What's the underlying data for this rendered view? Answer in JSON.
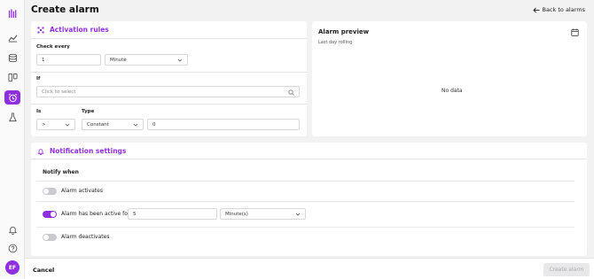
{
  "page": {
    "title": "Create alarm",
    "back_label": "Back to alarms"
  },
  "sidebar": {
    "icons": [
      "logo-bars-icon",
      "chart-icon",
      "layers-icon",
      "board-icon",
      "alarm-clock-icon",
      "flask-icon",
      "bell-icon",
      "help-icon"
    ],
    "avatar": "EF",
    "accent": "#8e2fe0"
  },
  "activation": {
    "title": "Activation rules",
    "check_every_label": "Check every",
    "check_every_value": "1",
    "check_every_unit": "Minute",
    "if_label": "If",
    "if_placeholder": "Click to select",
    "is_label": "Is",
    "is_value": ">",
    "type_label": "Type",
    "type_value": "Constant",
    "threshold_value": "0"
  },
  "preview": {
    "title": "Alarm preview",
    "subtitle": "Last day rolling",
    "empty_text": "No data"
  },
  "notification": {
    "title": "Notification settings",
    "notify_when_label": "Notify when",
    "rows": [
      {
        "label": "Alarm activates",
        "enabled": false
      },
      {
        "label": "Alarm has been active for",
        "enabled": true,
        "value": "5",
        "unit": "Minute(s)"
      },
      {
        "label": "Alarm deactivates",
        "enabled": false
      }
    ]
  },
  "footer": {
    "cancel_label": "Cancel",
    "create_label": "Create alarm"
  }
}
